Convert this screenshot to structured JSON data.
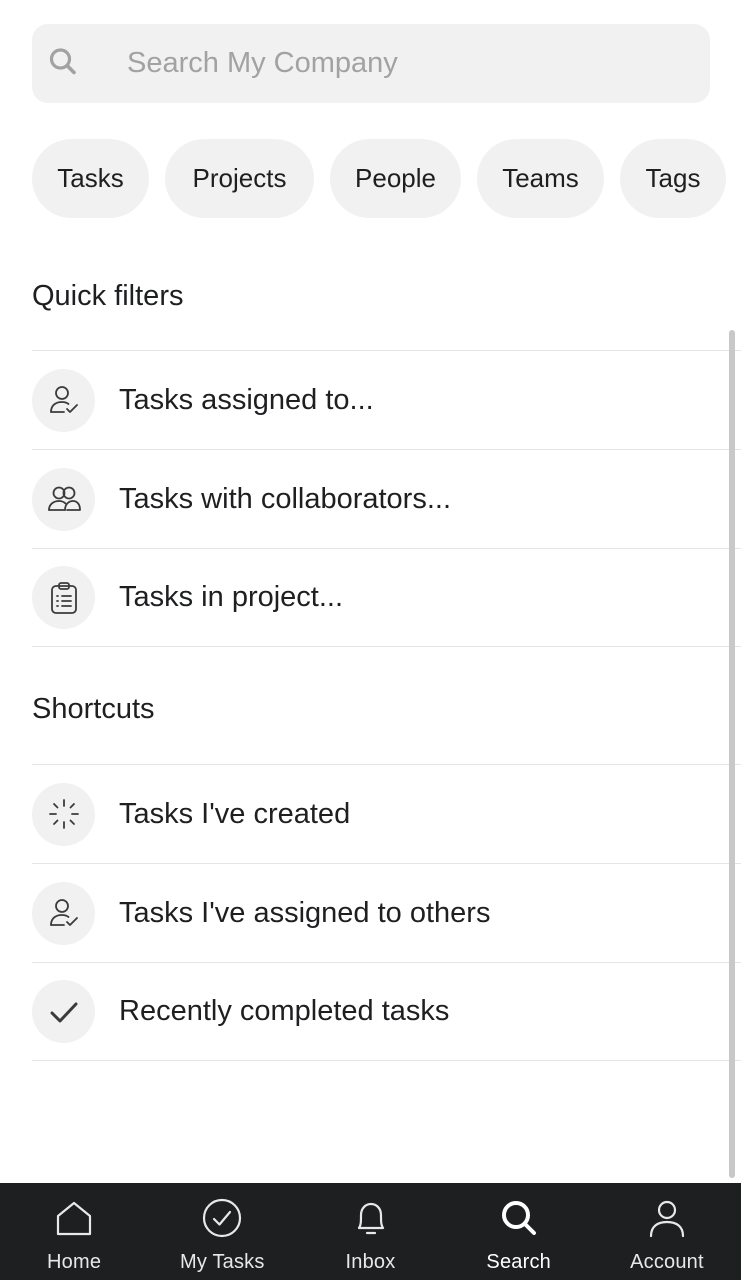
{
  "search": {
    "placeholder": "Search My Company"
  },
  "chips": [
    "Tasks",
    "Projects",
    "People",
    "Teams",
    "Tags"
  ],
  "quick_filters": {
    "title": "Quick filters",
    "items": [
      {
        "label": "Tasks assigned to...",
        "icon": "person-check-icon"
      },
      {
        "label": "Tasks with collaborators...",
        "icon": "people-icon"
      },
      {
        "label": "Tasks in project...",
        "icon": "clipboard-icon"
      }
    ]
  },
  "shortcuts": {
    "title": "Shortcuts",
    "items": [
      {
        "label": "Tasks I've created",
        "icon": "sparkle-icon"
      },
      {
        "label": "Tasks I've assigned to others",
        "icon": "person-check-icon"
      },
      {
        "label": "Recently completed tasks",
        "icon": "checkmark-icon"
      }
    ]
  },
  "tabbar": {
    "tabs": [
      {
        "label": "Home",
        "icon": "home-icon",
        "active": false
      },
      {
        "label": "My Tasks",
        "icon": "check-circle-icon",
        "active": false
      },
      {
        "label": "Inbox",
        "icon": "bell-icon",
        "active": false
      },
      {
        "label": "Search",
        "icon": "search-icon",
        "active": true
      },
      {
        "label": "Account",
        "icon": "person-icon",
        "active": false
      }
    ]
  },
  "colors": {
    "chip_bg": "#f2f1f1",
    "tabbar_bg": "#1e1f21",
    "text": "#1e1f21",
    "placeholder": "#a3a1a1"
  }
}
